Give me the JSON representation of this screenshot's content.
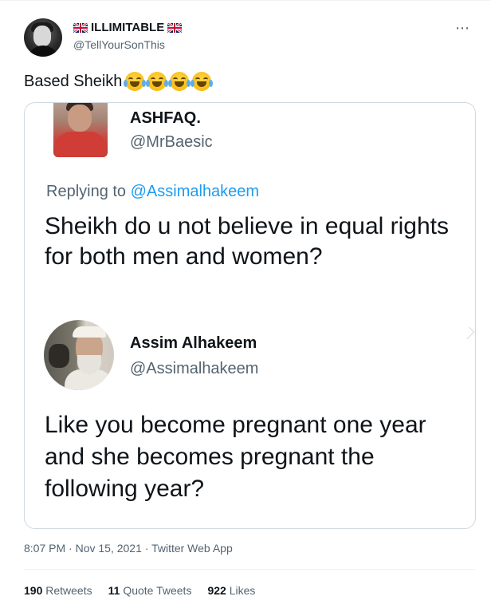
{
  "tweet": {
    "author_name": "ILLIMITABLE",
    "author_handle": "@TellYourSonThis",
    "author_flag_icon": "uk-flag-icon",
    "more_icon": "⋯",
    "text": "Based Sheikh",
    "emoji_icon": "joy-emoji-icon",
    "emoji_count": 4,
    "timestamp": "8:07 PM · Nov 15, 2021 · ",
    "source_app": "Twitter Web App",
    "stats": {
      "retweets_count": "190",
      "retweets_label": "Retweets",
      "quote_tweets_count": "11",
      "quote_tweets_label": "Quote Tweets",
      "likes_count": "922",
      "likes_label": "Likes"
    }
  },
  "embedded_image": {
    "question_author_name": "ASHFAQ.",
    "question_author_handle": "@MrBaesic",
    "replying_prefix": "Replying to ",
    "replying_mention": "@Assimalhakeem",
    "question_text": "Sheikh do u not believe in equal rights for both men and women?",
    "answer_author_name": "Assim Alhakeem",
    "answer_author_handle": "@Assimalhakeem",
    "answer_text": "Like you become pregnant one year and she becomes pregnant the following year?"
  },
  "colors": {
    "text_primary": "#0f1419",
    "text_secondary": "#536471",
    "link": "#1d9bf0",
    "border": "#cfd9de"
  }
}
